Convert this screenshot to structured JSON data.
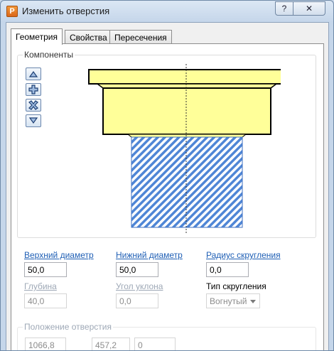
{
  "window": {
    "title": "Изменить отверстия",
    "help_label": "?",
    "close_label": "✕",
    "app_icon_label": "P"
  },
  "tabs": [
    {
      "label": "Геометрия",
      "active": true
    },
    {
      "label": "Свойства",
      "active": false
    },
    {
      "label": "Пересечения",
      "active": false
    }
  ],
  "components": {
    "label": "Компоненты",
    "buttons": [
      "move-up-icon",
      "add-icon",
      "delete-icon",
      "move-down-icon"
    ]
  },
  "fields": {
    "top_diameter": {
      "label": "Верхний диаметр",
      "value": "50,0"
    },
    "bottom_diameter": {
      "label": "Нижний диаметр",
      "value": "50,0"
    },
    "fillet_radius": {
      "label": "Радиус скругления",
      "value": "0,0"
    },
    "depth": {
      "label": "Глубина",
      "value": "40,0"
    },
    "taper_angle": {
      "label": "Угол уклона",
      "value": "0,0"
    },
    "fillet_type": {
      "label": "Тип скругления",
      "value": "Вогнутый"
    }
  },
  "position": {
    "label": "Положение отверстия",
    "x": "1066,8",
    "y": "457,2",
    "z": "0"
  },
  "colors": {
    "hole_fill": "#ffff99",
    "hatch": "#4f86d6",
    "link": "#1f5fb5"
  }
}
